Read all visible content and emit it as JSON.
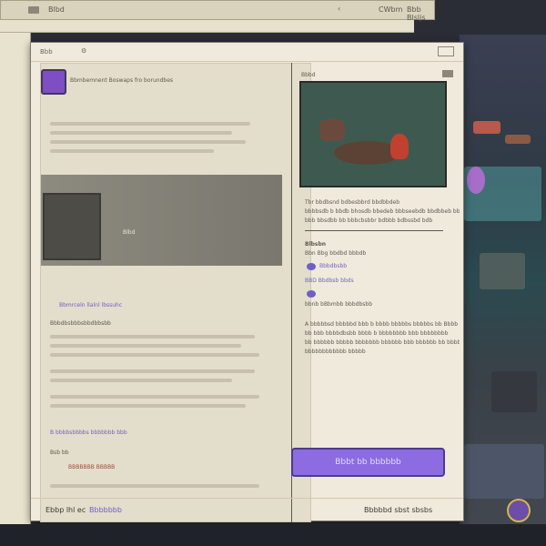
{
  "top_bar": {
    "left_label": "Blbd",
    "right_label1": "CWbm",
    "right_label2": "Bbb Blsljs"
  },
  "window": {
    "header_label": "Bbb",
    "game_title": "Bbmbemnent Boswaps fro borundbes",
    "hud_label": "Blbd",
    "read_more_label": "Bbmrceln llalnl lbssuhc",
    "preview_label": "Bbbd",
    "description_line1": "Tbr bbdbsnd bdbesbbrd bbdbbdeb",
    "description_line2": "bbbbsdb b bbdb bhosdb bbedeb bbbseebdb bbdbbeb bbs",
    "description_line3": "bbb bbsdbb bb bbbcbsbbr bdbbb bdbssbd bdb",
    "section_title": "Blbsbn",
    "meta_item1": "Bbn Bbg bbdbd bbbdb",
    "meta_item2": "Bbbdbsbb",
    "meta_item3": "BBD Bbdbsb bbds",
    "meta_item4": "bbnb bBbmbb bbbdbsbb",
    "paragraph_line1": "A bbbbbsd bbbbbd bbb b bbbb bbbbbs bbbbbs bb Bbbb",
    "paragraph_line2": "bb bbb bbbbdbsbb bbbb b bbbbbbbb bbb bbbbbbbb",
    "paragraph_line3": "bb bbbbbb bbbbb bbbbbbb bbbbbb bbb bbbbbb bb bbbbbb",
    "paragraph_line4": "bbbbbbbbbbbb bbbbb",
    "play_button_label": "Bbbt bb bbbbbb",
    "left_link1": "Bbbdbsbbbsbbdbbsbb",
    "left_link2": "B bbbbsbbbbs bbbbbbb bbb",
    "left_small_label": "Bsb bb",
    "left_tag": "BBBBBBB BBBBB",
    "footer_left": "Ebbp lhl ec",
    "footer_left_link": "Bbbbbbb",
    "footer_right": "Bbbbbd sbst sbsbs"
  },
  "colors": {
    "accent": "#8c6ce0",
    "panel": "#efeadb",
    "link": "#6f5fc7"
  },
  "icons": [
    "game-logo-icon",
    "expand-icon",
    "close-icon",
    "controller-icon",
    "chat-icon"
  ]
}
